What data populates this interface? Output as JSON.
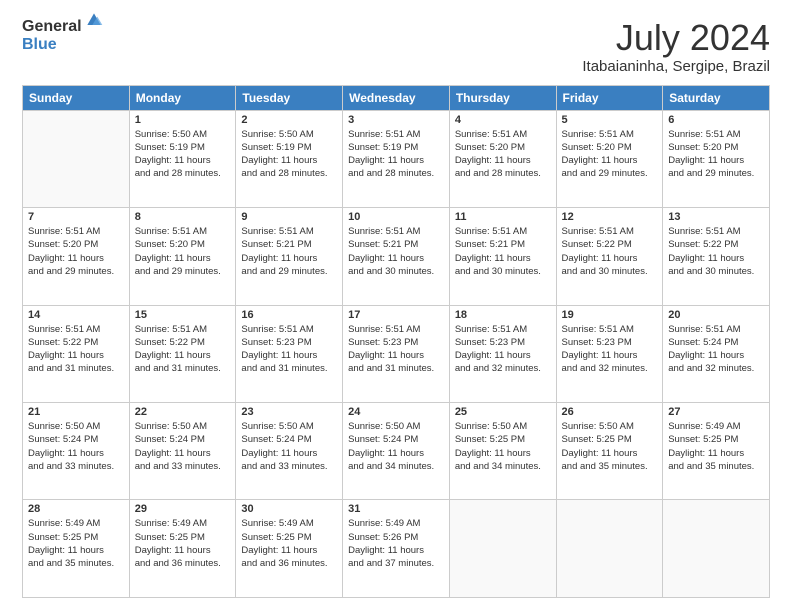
{
  "logo": {
    "general": "General",
    "blue": "Blue"
  },
  "title": {
    "month_year": "July 2024",
    "location": "Itabaianinha, Sergipe, Brazil"
  },
  "days_of_week": [
    "Sunday",
    "Monday",
    "Tuesday",
    "Wednesday",
    "Thursday",
    "Friday",
    "Saturday"
  ],
  "weeks": [
    [
      {
        "day": "",
        "sunrise": "",
        "sunset": "",
        "daylight": ""
      },
      {
        "day": "1",
        "sunrise": "Sunrise: 5:50 AM",
        "sunset": "Sunset: 5:19 PM",
        "daylight": "Daylight: 11 hours and 28 minutes."
      },
      {
        "day": "2",
        "sunrise": "Sunrise: 5:50 AM",
        "sunset": "Sunset: 5:19 PM",
        "daylight": "Daylight: 11 hours and 28 minutes."
      },
      {
        "day": "3",
        "sunrise": "Sunrise: 5:51 AM",
        "sunset": "Sunset: 5:19 PM",
        "daylight": "Daylight: 11 hours and 28 minutes."
      },
      {
        "day": "4",
        "sunrise": "Sunrise: 5:51 AM",
        "sunset": "Sunset: 5:20 PM",
        "daylight": "Daylight: 11 hours and 28 minutes."
      },
      {
        "day": "5",
        "sunrise": "Sunrise: 5:51 AM",
        "sunset": "Sunset: 5:20 PM",
        "daylight": "Daylight: 11 hours and 29 minutes."
      },
      {
        "day": "6",
        "sunrise": "Sunrise: 5:51 AM",
        "sunset": "Sunset: 5:20 PM",
        "daylight": "Daylight: 11 hours and 29 minutes."
      }
    ],
    [
      {
        "day": "7",
        "sunrise": "Sunrise: 5:51 AM",
        "sunset": "Sunset: 5:20 PM",
        "daylight": "Daylight: 11 hours and 29 minutes."
      },
      {
        "day": "8",
        "sunrise": "Sunrise: 5:51 AM",
        "sunset": "Sunset: 5:20 PM",
        "daylight": "Daylight: 11 hours and 29 minutes."
      },
      {
        "day": "9",
        "sunrise": "Sunrise: 5:51 AM",
        "sunset": "Sunset: 5:21 PM",
        "daylight": "Daylight: 11 hours and 29 minutes."
      },
      {
        "day": "10",
        "sunrise": "Sunrise: 5:51 AM",
        "sunset": "Sunset: 5:21 PM",
        "daylight": "Daylight: 11 hours and 30 minutes."
      },
      {
        "day": "11",
        "sunrise": "Sunrise: 5:51 AM",
        "sunset": "Sunset: 5:21 PM",
        "daylight": "Daylight: 11 hours and 30 minutes."
      },
      {
        "day": "12",
        "sunrise": "Sunrise: 5:51 AM",
        "sunset": "Sunset: 5:22 PM",
        "daylight": "Daylight: 11 hours and 30 minutes."
      },
      {
        "day": "13",
        "sunrise": "Sunrise: 5:51 AM",
        "sunset": "Sunset: 5:22 PM",
        "daylight": "Daylight: 11 hours and 30 minutes."
      }
    ],
    [
      {
        "day": "14",
        "sunrise": "Sunrise: 5:51 AM",
        "sunset": "Sunset: 5:22 PM",
        "daylight": "Daylight: 11 hours and 31 minutes."
      },
      {
        "day": "15",
        "sunrise": "Sunrise: 5:51 AM",
        "sunset": "Sunset: 5:22 PM",
        "daylight": "Daylight: 11 hours and 31 minutes."
      },
      {
        "day": "16",
        "sunrise": "Sunrise: 5:51 AM",
        "sunset": "Sunset: 5:23 PM",
        "daylight": "Daylight: 11 hours and 31 minutes."
      },
      {
        "day": "17",
        "sunrise": "Sunrise: 5:51 AM",
        "sunset": "Sunset: 5:23 PM",
        "daylight": "Daylight: 11 hours and 31 minutes."
      },
      {
        "day": "18",
        "sunrise": "Sunrise: 5:51 AM",
        "sunset": "Sunset: 5:23 PM",
        "daylight": "Daylight: 11 hours and 32 minutes."
      },
      {
        "day": "19",
        "sunrise": "Sunrise: 5:51 AM",
        "sunset": "Sunset: 5:23 PM",
        "daylight": "Daylight: 11 hours and 32 minutes."
      },
      {
        "day": "20",
        "sunrise": "Sunrise: 5:51 AM",
        "sunset": "Sunset: 5:24 PM",
        "daylight": "Daylight: 11 hours and 32 minutes."
      }
    ],
    [
      {
        "day": "21",
        "sunrise": "Sunrise: 5:50 AM",
        "sunset": "Sunset: 5:24 PM",
        "daylight": "Daylight: 11 hours and 33 minutes."
      },
      {
        "day": "22",
        "sunrise": "Sunrise: 5:50 AM",
        "sunset": "Sunset: 5:24 PM",
        "daylight": "Daylight: 11 hours and 33 minutes."
      },
      {
        "day": "23",
        "sunrise": "Sunrise: 5:50 AM",
        "sunset": "Sunset: 5:24 PM",
        "daylight": "Daylight: 11 hours and 33 minutes."
      },
      {
        "day": "24",
        "sunrise": "Sunrise: 5:50 AM",
        "sunset": "Sunset: 5:24 PM",
        "daylight": "Daylight: 11 hours and 34 minutes."
      },
      {
        "day": "25",
        "sunrise": "Sunrise: 5:50 AM",
        "sunset": "Sunset: 5:25 PM",
        "daylight": "Daylight: 11 hours and 34 minutes."
      },
      {
        "day": "26",
        "sunrise": "Sunrise: 5:50 AM",
        "sunset": "Sunset: 5:25 PM",
        "daylight": "Daylight: 11 hours and 35 minutes."
      },
      {
        "day": "27",
        "sunrise": "Sunrise: 5:49 AM",
        "sunset": "Sunset: 5:25 PM",
        "daylight": "Daylight: 11 hours and 35 minutes."
      }
    ],
    [
      {
        "day": "28",
        "sunrise": "Sunrise: 5:49 AM",
        "sunset": "Sunset: 5:25 PM",
        "daylight": "Daylight: 11 hours and 35 minutes."
      },
      {
        "day": "29",
        "sunrise": "Sunrise: 5:49 AM",
        "sunset": "Sunset: 5:25 PM",
        "daylight": "Daylight: 11 hours and 36 minutes."
      },
      {
        "day": "30",
        "sunrise": "Sunrise: 5:49 AM",
        "sunset": "Sunset: 5:25 PM",
        "daylight": "Daylight: 11 hours and 36 minutes."
      },
      {
        "day": "31",
        "sunrise": "Sunrise: 5:49 AM",
        "sunset": "Sunset: 5:26 PM",
        "daylight": "Daylight: 11 hours and 37 minutes."
      },
      {
        "day": "",
        "sunrise": "",
        "sunset": "",
        "daylight": ""
      },
      {
        "day": "",
        "sunrise": "",
        "sunset": "",
        "daylight": ""
      },
      {
        "day": "",
        "sunrise": "",
        "sunset": "",
        "daylight": ""
      }
    ]
  ]
}
